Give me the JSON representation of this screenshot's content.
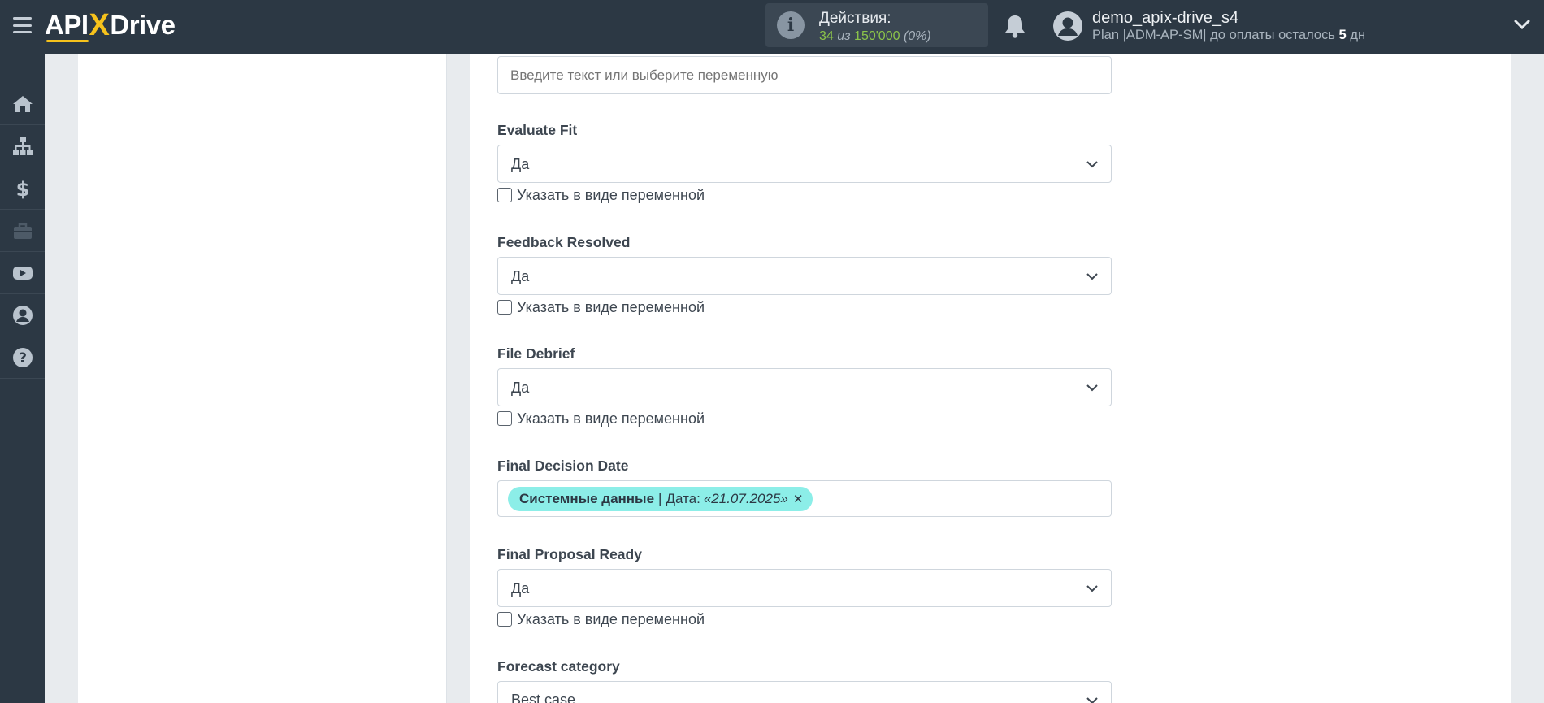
{
  "header": {
    "logo": {
      "api": "API",
      "x": "X",
      "drive": "Drive"
    },
    "actions": {
      "title": "Действия:",
      "used": "34",
      "of": "из",
      "total": "150'000",
      "percent": "(0%)"
    },
    "user": {
      "name": "demo_apix-drive_s4",
      "plan_prefix": "Plan |ADM-AP-SM| до оплаты осталось",
      "days": "5",
      "days_unit": "дн"
    }
  },
  "sidebar": {
    "items": [
      {
        "icon": "home-icon"
      },
      {
        "icon": "sitemap-icon"
      },
      {
        "icon": "dollar-icon"
      },
      {
        "icon": "briefcase-icon"
      },
      {
        "icon": "youtube-icon"
      },
      {
        "icon": "user-circle-icon"
      },
      {
        "icon": "question-circle-icon"
      }
    ]
  },
  "form": {
    "top_input_placeholder": "Введите текст или выберите переменную",
    "checkbox_label": "Указать в виде переменной",
    "fields": [
      {
        "label": "Evaluate Fit",
        "value": "Да"
      },
      {
        "label": "Feedback Resolved",
        "value": "Да"
      },
      {
        "label": "File Debrief",
        "value": "Да"
      },
      {
        "label": "Final Decision Date",
        "tag": {
          "source": "Системные данные",
          "sep": "|",
          "field": "Дата:",
          "value": "«21.07.2025»",
          "remove": "✕"
        }
      },
      {
        "label": "Final Proposal Ready",
        "value": "Да"
      },
      {
        "label": "Forecast category",
        "value": "Best case"
      }
    ]
  },
  "colors": {
    "topbar": "#2c3844",
    "accent": "#f6c21c",
    "tag": "#8ceee8",
    "green": "#8bc34a"
  }
}
